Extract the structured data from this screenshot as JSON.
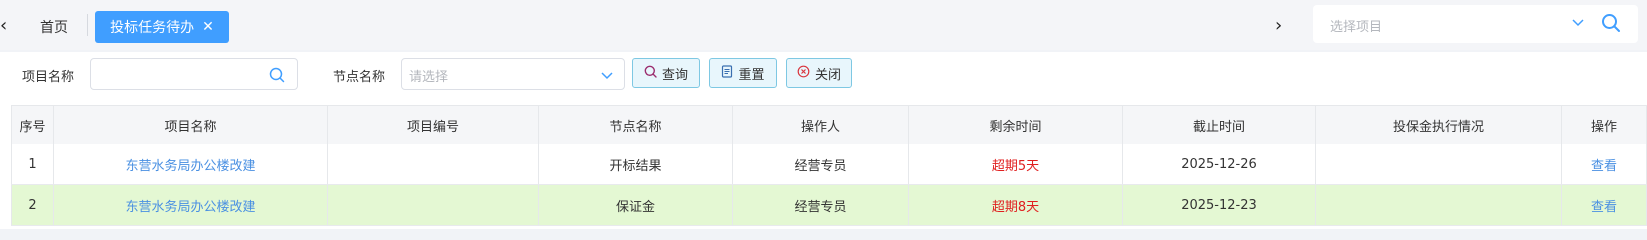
{
  "tabs": {
    "home_label": "首页",
    "active_label": "投标任务待办",
    "close_glyph": "✕",
    "prev_glyph": "‹",
    "next_glyph": "›"
  },
  "project_select": {
    "placeholder": "选择项目",
    "chevron_icon": "chevron-down-icon",
    "search_icon": "search-icon"
  },
  "filters": {
    "project_label": "项目名称",
    "project_value": "",
    "node_label": "节点名称",
    "node_placeholder": "请选择",
    "query_label": "查询",
    "reset_label": "重置",
    "close_label": "关闭"
  },
  "table": {
    "headers": [
      "序号",
      "项目名称",
      "项目编号",
      "节点名称",
      "操作人",
      "剩余时间",
      "截止时间",
      "投保金执行情况",
      "操作"
    ],
    "rows": [
      {
        "seq": "1",
        "name": "东营水务局办公楼改建",
        "code": "",
        "node": "开标结果",
        "operator": "经营专员",
        "remaining": "超期5天",
        "deadline": "2025-12-26",
        "bond": "",
        "action": "查看"
      },
      {
        "seq": "2",
        "name": "东营水务局办公楼改建",
        "code": "",
        "node": "保证金",
        "operator": "经营专员",
        "remaining": "超期8天",
        "deadline": "2025-12-23",
        "bond": "",
        "action": "查看"
      }
    ]
  },
  "colors": {
    "accent": "#409eff",
    "link": "#4a90e2",
    "overdue": "#e02020",
    "highlight_row": "#e4f8d3"
  }
}
